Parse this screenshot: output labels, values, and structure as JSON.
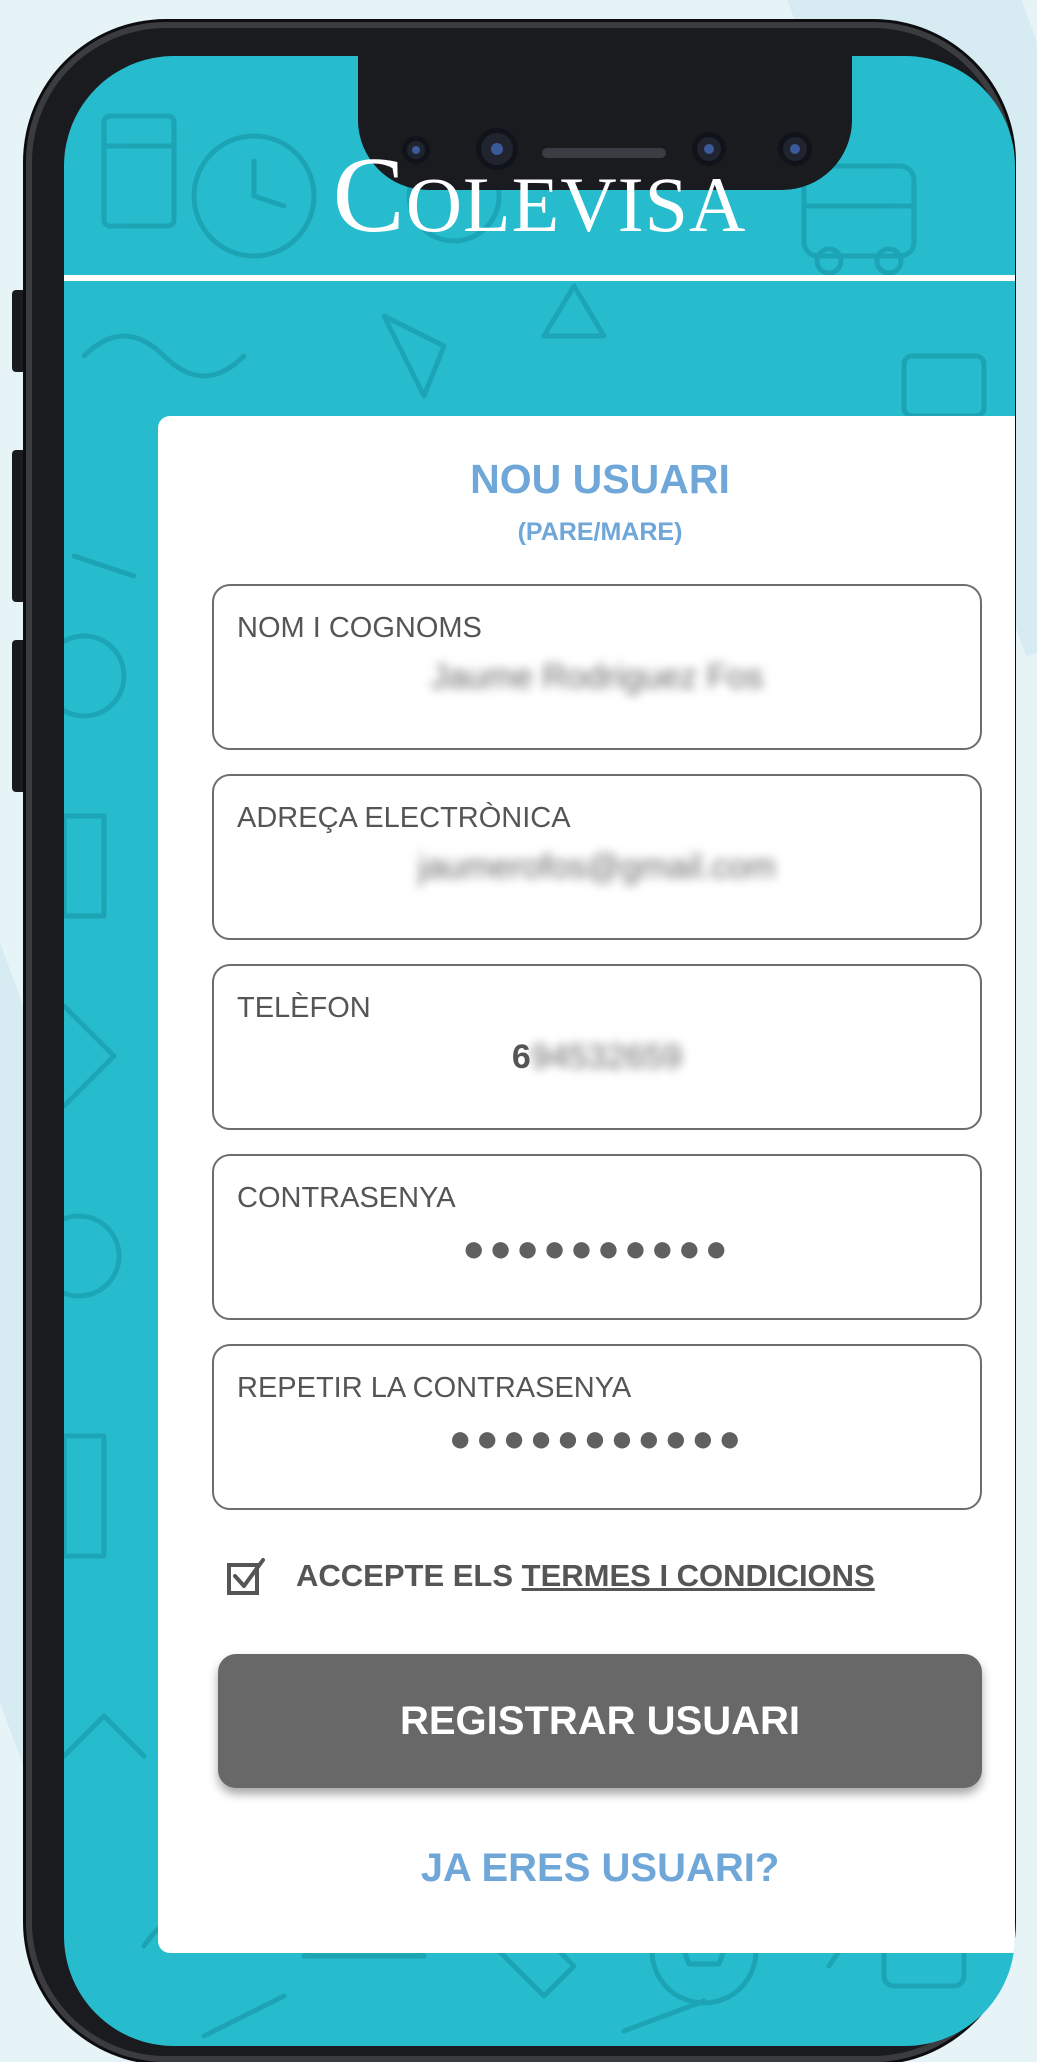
{
  "app": {
    "logo_text": "COLEVISA",
    "logo_first_letter": "C",
    "logo_rest": "OLEVISA"
  },
  "form": {
    "title": "NOU USUARI",
    "subtitle": "(PARE/MARE)",
    "fields": [
      {
        "label": "NOM I COGNOMS",
        "value": "Jaume Rodriguez Fos"
      },
      {
        "label": "ADREÇA ELECTRÒNICA",
        "value": "jaumerofos@gmail.com"
      },
      {
        "label": "TELÈFON",
        "value_visible": "6",
        "value_obscured": "94532659"
      },
      {
        "label": "CONTRASENYA",
        "value": "●●●●●●●●●●"
      },
      {
        "label": "REPETIR LA CONTRASENYA",
        "value": "●●●●●●●●●●●"
      }
    ],
    "terms": {
      "checked": true,
      "prefix": "ACCEPTE ELS ",
      "link": "TERMES I CONDICIONS"
    },
    "submit_label": "REGISTRAR USUARI",
    "login_link": "JA ERES USUARI?"
  },
  "colors": {
    "background_teal": "#27bccd",
    "accent_blue": "#6fa7d8",
    "button_gray": "#686868",
    "text_gray": "#555555"
  }
}
